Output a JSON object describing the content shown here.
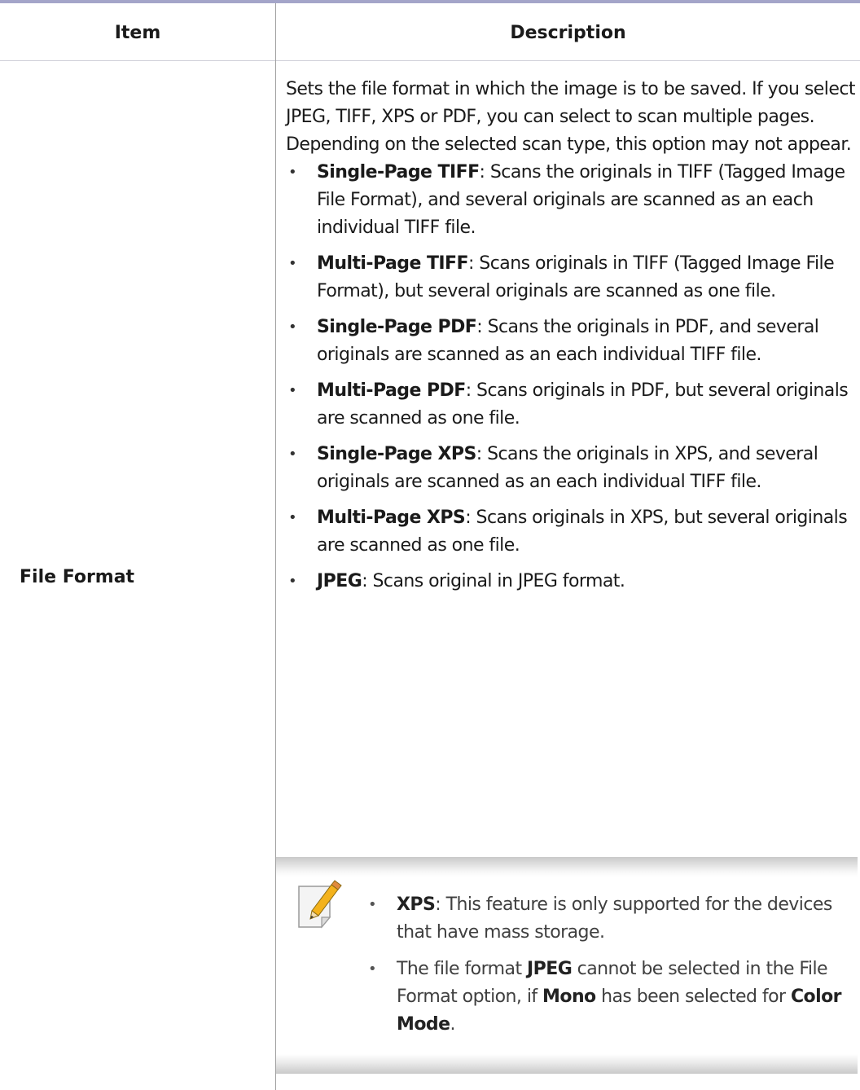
{
  "table": {
    "headers": {
      "item": "Item",
      "description": "Description"
    },
    "row": {
      "item": "File Format",
      "intro": "Sets the file format in which the image is to be saved. If you select JPEG, TIFF, XPS or PDF, you can select to scan multiple pages. Depending on the selected scan type, this option may not appear.",
      "options": [
        {
          "term": "Single-Page TIFF",
          "text": ": Scans the originals in TIFF (Tagged Image File Format), and several originals are scanned as an each individual TIFF file."
        },
        {
          "term": "Multi-Page TIFF",
          "text": ": Scans originals in TIFF (Tagged Image File Format), but several originals are scanned as one file."
        },
        {
          "term": "Single-Page PDF",
          "text": ": Scans the originals in PDF, and several originals are scanned as an each individual TIFF file."
        },
        {
          "term": "Multi-Page PDF",
          "text": ": Scans originals in PDF, but several originals are scanned as one file."
        },
        {
          "term": "Single-Page XPS",
          "text": ": Scans the originals in XPS, and several originals are scanned as an each individual TIFF file."
        },
        {
          "term": "Multi-Page XPS",
          "text": ": Scans originals in XPS, but several originals are scanned as one file."
        },
        {
          "term": "JPEG",
          "text": ": Scans original in JPEG format."
        }
      ]
    }
  },
  "note": {
    "icon": "note-pencil-icon",
    "item1": {
      "term": "XPS",
      "text": ": This feature is only supported for the devices that have mass storage."
    },
    "item2": {
      "t1": "The file format ",
      "b1": "JPEG",
      "t2": " cannot be selected in the File Format option, if ",
      "b2": "Mono",
      "t3": " has been selected for ",
      "b3": "Color Mode",
      "t4": "."
    }
  },
  "colors": {
    "top_rule": "#a4a5c9",
    "divider": "#a0a0a0",
    "note_text": "#3f3f3f"
  }
}
